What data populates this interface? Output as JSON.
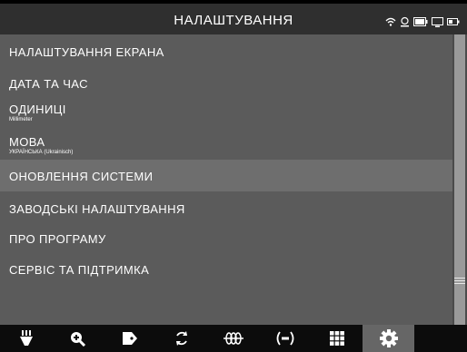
{
  "header": {
    "title": "НАЛАШТУВАННЯ"
  },
  "status_icons": [
    "wifi-icon",
    "location-icon",
    "battery-icon",
    "monitor-icon",
    "battery-small-icon"
  ],
  "menu": {
    "items": [
      {
        "label": "НАЛАШТУВАННЯ ЕКРАНА",
        "sub": ""
      },
      {
        "label": "ДАТА ТА ЧАС",
        "sub": ""
      },
      {
        "label": "ОДИНИЦІ",
        "sub": "Millimeter"
      },
      {
        "label": "МОВА",
        "sub": "УКРАЇНСЬКА (Ukrainisch)"
      },
      {
        "label": "ОНОВЛЕННЯ СИСТЕМИ",
        "sub": "",
        "selected": true
      },
      {
        "label": "ЗАВОДСЬКІ НАЛАШТУВАННЯ",
        "sub": ""
      },
      {
        "label": "ПРО ПРОГРАМУ",
        "sub": ""
      },
      {
        "label": "СЕРВІС ТА ПІДТРИМКА",
        "sub": ""
      }
    ]
  },
  "toolbar": {
    "items": [
      {
        "icon": "scan-icon"
      },
      {
        "icon": "zoom-in-icon"
      },
      {
        "icon": "tag-icon"
      },
      {
        "icon": "refresh-icon"
      },
      {
        "icon": "coil-icon"
      },
      {
        "icon": "signal-icon"
      },
      {
        "icon": "grid-icon"
      },
      {
        "icon": "settings-gear-icon",
        "active": true
      }
    ]
  },
  "colors": {
    "background": "#5b5b5b",
    "selected_row": "#6e6e6e",
    "toolbar": "#0c0c0c",
    "active_tool": "#666666"
  }
}
